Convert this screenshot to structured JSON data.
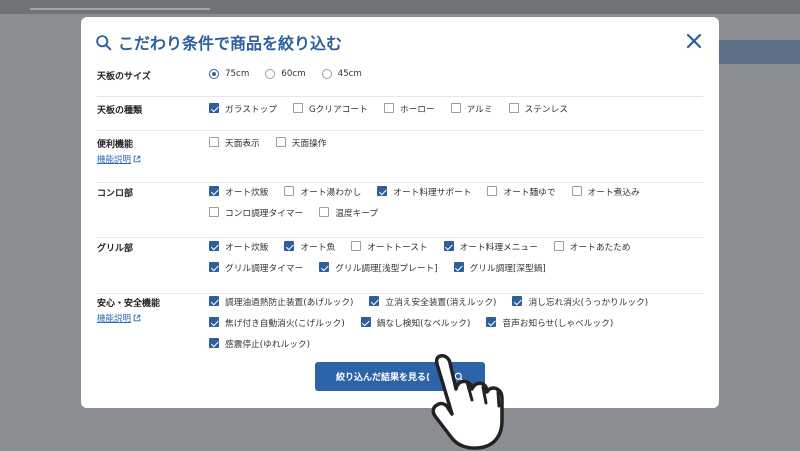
{
  "modal": {
    "title": "こだわり条件で商品を絞り込む",
    "close_icon": "close-icon",
    "search_icon": "search-icon"
  },
  "link_label": "機能説明",
  "sections": {
    "size": {
      "label": "天板のサイズ",
      "options": [
        {
          "label": "75cm",
          "selected": true
        },
        {
          "label": "60cm",
          "selected": false
        },
        {
          "label": "45cm",
          "selected": false
        }
      ]
    },
    "type": {
      "label": "天板の種類",
      "options": [
        {
          "label": "ガラストップ",
          "checked": true
        },
        {
          "label": "Gクリアコート",
          "checked": false
        },
        {
          "label": "ホーロー",
          "checked": false
        },
        {
          "label": "アルミ",
          "checked": false
        },
        {
          "label": "ステンレス",
          "checked": false
        }
      ]
    },
    "convenience": {
      "label": "便利機能",
      "options": [
        {
          "label": "天面表示",
          "checked": false
        },
        {
          "label": "天面操作",
          "checked": false
        }
      ]
    },
    "stove": {
      "label": "コンロ部",
      "options": [
        {
          "label": "オート炊飯",
          "checked": true
        },
        {
          "label": "オート湯わかし",
          "checked": false
        },
        {
          "label": "オート料理サポート",
          "checked": true
        },
        {
          "label": "オート麺ゆで",
          "checked": false
        },
        {
          "label": "オート煮込み",
          "checked": false
        },
        {
          "label": "コンロ調理タイマー",
          "checked": false
        },
        {
          "label": "温度キープ",
          "checked": false
        }
      ]
    },
    "grill": {
      "label": "グリル部",
      "options": [
        {
          "label": "オート炊飯",
          "checked": true
        },
        {
          "label": "オート魚",
          "checked": true
        },
        {
          "label": "オートトースト",
          "checked": false
        },
        {
          "label": "オート料理メニュー",
          "checked": true
        },
        {
          "label": "オートあたため",
          "checked": false
        },
        {
          "label": "グリル調理タイマー",
          "checked": true
        },
        {
          "label": "グリル調理[浅型プレート]",
          "checked": true
        },
        {
          "label": "グリル調理[深型鍋]",
          "checked": true
        }
      ]
    },
    "safety": {
      "label": "安心・安全機能",
      "options": [
        {
          "label": "調理油過熱防止装置(あげルック)",
          "checked": true
        },
        {
          "label": "立消え安全装置(消えルック)",
          "checked": true
        },
        {
          "label": "消し忘れ消火(うっかりルック)",
          "checked": true
        },
        {
          "label": "焦げ付き自動消火(こげルック)",
          "checked": true
        },
        {
          "label": "鍋なし検知(なベルック)",
          "checked": true
        },
        {
          "label": "音声お知らせ(しゃべルック)",
          "checked": true
        },
        {
          "label": "感震停止(ゆれルック)",
          "checked": true
        }
      ]
    }
  },
  "submit": {
    "label": "絞り込んだ結果を見る(",
    "icon": "search-icon"
  },
  "colors": {
    "accent": "#2d5f9a",
    "button": "#2d63a8",
    "overlay": "#7f8387"
  }
}
